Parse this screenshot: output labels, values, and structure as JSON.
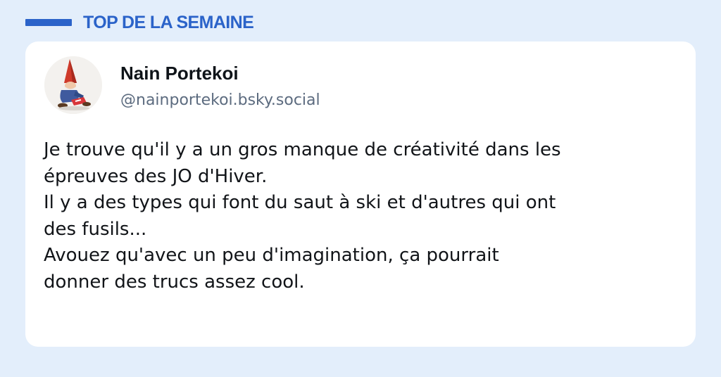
{
  "header": {
    "title": "TOP DE LA SEMAINE",
    "accent_color": "#2b63c9"
  },
  "post": {
    "author": {
      "name": "Nain Portekoi",
      "handle": "@nainportekoi.bsky.social",
      "avatar_icon": "garden-gnome-avatar"
    },
    "lines": [
      "Je trouve qu'il y a un gros manque de créativité dans les",
      "épreuves des JO d'Hiver.",
      "Il y a des types qui font du saut à ski et d'autres qui ont",
      "des fusils...",
      "Avouez qu'avec un peu d'imagination, ça pourrait",
      "donner des trucs assez cool."
    ]
  },
  "colors": {
    "background": "#e3eefb",
    "card": "#ffffff",
    "text": "#111418",
    "handle": "#5c6b7f"
  }
}
